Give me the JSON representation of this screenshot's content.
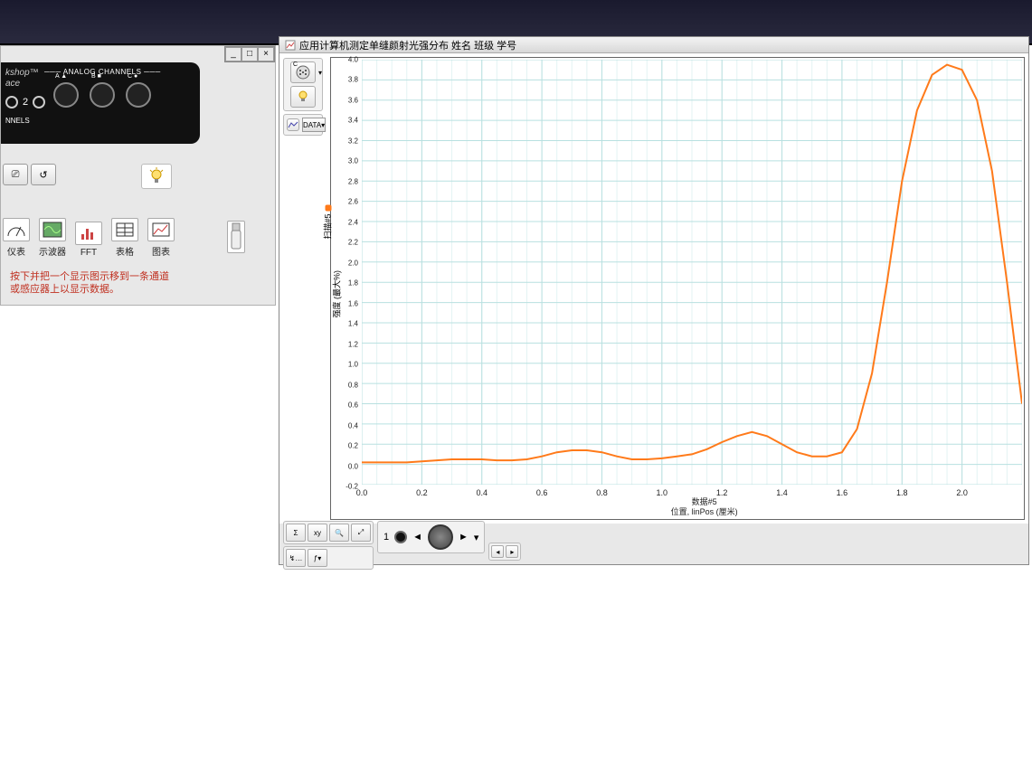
{
  "top_bar": {},
  "left_panel": {
    "brand_suffix": "kshop™",
    "brand_sub": "ace",
    "analog_label": "ANALOG CHANNELS",
    "port_a": "A ▲",
    "port_b": "B ■",
    "port_c": "C ●",
    "digital_num": "2",
    "nnels": "NNELS",
    "hint": "按下并把一个显示图示移到一条通道或感应器上以显示数据。",
    "displays": {
      "meter": "仪表",
      "scope": "示波器",
      "fft": "FFT",
      "table": "表格",
      "graph": "图表"
    }
  },
  "graph": {
    "title": "应用计算机测定单缝颜射光强分布  姓名 班级 学号",
    "data_btn": "DATA▾",
    "y_series": "扫描#5",
    "y_label": "强度 (最大%)",
    "x_series": "数据#5",
    "x_label": "位置, linPos (厘米)",
    "nav_num": "1"
  },
  "chart_data": {
    "type": "line",
    "title": "应用计算机测定单缝颜射光强分布",
    "xlabel": "位置, linPos (厘米)",
    "ylabel": "强度 (最大%)",
    "xlim": [
      0.0,
      2.2
    ],
    "ylim": [
      -0.2,
      4.0
    ],
    "x_ticks": [
      0.0,
      0.2,
      0.4,
      0.6,
      0.8,
      1.0,
      1.2,
      1.4,
      1.6,
      1.8,
      2.0
    ],
    "y_ticks": [
      -0.2,
      0.0,
      0.2,
      0.4,
      0.6,
      0.8,
      1.0,
      1.2,
      1.4,
      1.6,
      1.8,
      2.0,
      2.2,
      2.4,
      2.6,
      2.8,
      3.0,
      3.2,
      3.4,
      3.6,
      3.8,
      4.0
    ],
    "series": [
      {
        "name": "扫描#5",
        "color": "#ff7a1a",
        "x": [
          0.0,
          0.05,
          0.1,
          0.15,
          0.2,
          0.25,
          0.3,
          0.35,
          0.4,
          0.45,
          0.5,
          0.55,
          0.6,
          0.65,
          0.7,
          0.75,
          0.8,
          0.85,
          0.9,
          0.95,
          1.0,
          1.05,
          1.1,
          1.15,
          1.2,
          1.25,
          1.3,
          1.35,
          1.4,
          1.45,
          1.5,
          1.55,
          1.6,
          1.65,
          1.7,
          1.75,
          1.8,
          1.85,
          1.9,
          1.95,
          2.0,
          2.05,
          2.1,
          2.15,
          2.2
        ],
        "y": [
          0.02,
          0.02,
          0.02,
          0.02,
          0.03,
          0.04,
          0.05,
          0.05,
          0.05,
          0.04,
          0.04,
          0.05,
          0.08,
          0.12,
          0.14,
          0.14,
          0.12,
          0.08,
          0.05,
          0.05,
          0.06,
          0.08,
          0.1,
          0.15,
          0.22,
          0.28,
          0.32,
          0.28,
          0.2,
          0.12,
          0.08,
          0.08,
          0.12,
          0.35,
          0.9,
          1.8,
          2.8,
          3.5,
          3.85,
          3.95,
          3.9,
          3.6,
          2.9,
          1.8,
          0.6
        ]
      }
    ]
  }
}
